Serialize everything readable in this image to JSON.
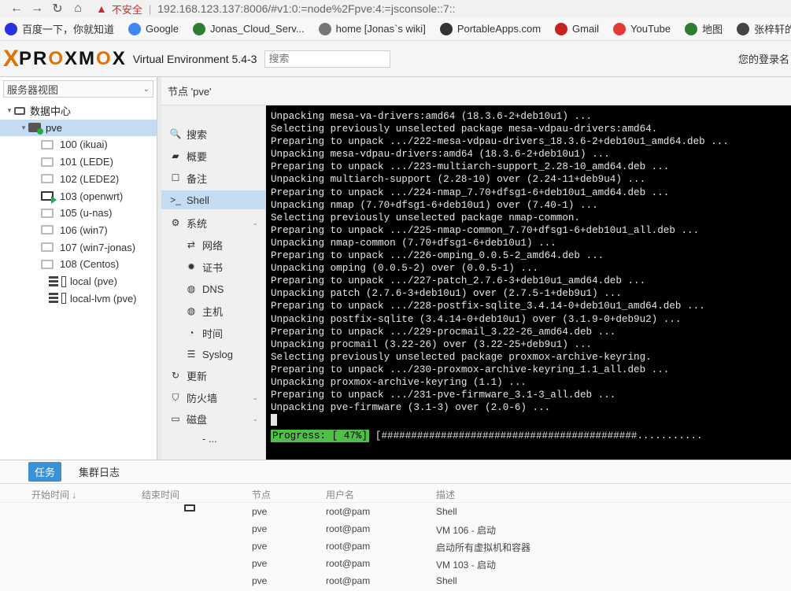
{
  "browser": {
    "security_label": "不安全",
    "url": "192.168.123.137:8006/#v1:0:=node%2Fpve:4:=jsconsole::7::",
    "bookmarks": [
      {
        "label": "百度一下，你就知道",
        "icon": "baidu-icon",
        "color": "#2932e1"
      },
      {
        "label": "Google",
        "icon": "google-icon",
        "color": "#4285f4"
      },
      {
        "label": "Jonas_Cloud_Serv...",
        "icon": "cloud-icon",
        "color": "#2e7d32"
      },
      {
        "label": "home [Jonas`s wiki]",
        "icon": "wiki-icon",
        "color": "#777777"
      },
      {
        "label": "PortableApps.com",
        "icon": "portableapps-icon",
        "color": "#333333"
      },
      {
        "label": "Gmail",
        "icon": "gmail-icon",
        "color": "#c5221f"
      },
      {
        "label": "YouTube",
        "icon": "youtube-icon",
        "color": "#e53935"
      },
      {
        "label": "地图",
        "icon": "maps-icon",
        "color": "#2e7d32"
      },
      {
        "label": "张梓轩的",
        "icon": "globe-icon",
        "color": "#444444"
      }
    ]
  },
  "header": {
    "logo_x": "X",
    "logo_text_1": "PR",
    "logo_text_o1": "O",
    "logo_text_2": "XM",
    "logo_text_o2": "O",
    "logo_text_3": "X",
    "version": "Virtual Environment 5.4-3",
    "search_placeholder": "搜索",
    "login_text": "您的登录名"
  },
  "sidebar": {
    "view_label": "服务器视图",
    "datacenter": "数据中心",
    "node": "pve",
    "vms": [
      {
        "label": "100 (ikuai)",
        "running": false
      },
      {
        "label": "101 (LEDE)",
        "running": false
      },
      {
        "label": "102 (LEDE2)",
        "running": false
      },
      {
        "label": "103 (openwrt)",
        "running": true
      },
      {
        "label": "105 (u-nas)",
        "running": false
      },
      {
        "label": "106 (win7)",
        "running": false
      },
      {
        "label": "107 (win7-jonas)",
        "running": false
      },
      {
        "label": "108 (Centos)",
        "running": false
      }
    ],
    "storage": [
      "local (pve)",
      "local-lvm (pve)"
    ]
  },
  "content": {
    "node_title": "节点 'pve'"
  },
  "nav": {
    "items": [
      {
        "label": "搜索",
        "icon": "search-icon",
        "glyph": "🔍",
        "sub": false,
        "active": false
      },
      {
        "label": "概要",
        "icon": "book-icon",
        "glyph": "▰",
        "sub": false,
        "active": false
      },
      {
        "label": "备注",
        "icon": "note-icon",
        "glyph": "☐",
        "sub": false,
        "active": false
      },
      {
        "label": "Shell",
        "icon": "terminal-icon",
        "glyph": ">_",
        "sub": false,
        "active": true
      },
      {
        "label": "系统",
        "icon": "gears-icon",
        "glyph": "⚙",
        "sub": false,
        "active": false,
        "expandable": true
      },
      {
        "label": "网络",
        "icon": "network-icon",
        "glyph": "⇄",
        "sub": true,
        "active": false
      },
      {
        "label": "证书",
        "icon": "certificate-icon",
        "glyph": "✹",
        "sub": true,
        "active": false
      },
      {
        "label": "DNS",
        "icon": "globe-icon",
        "glyph": "◍",
        "sub": true,
        "active": false
      },
      {
        "label": "主机",
        "icon": "globe-icon",
        "glyph": "◍",
        "sub": true,
        "active": false
      },
      {
        "label": "时间",
        "icon": "clock-icon",
        "glyph": "◔",
        "sub": true,
        "active": false
      },
      {
        "label": "Syslog",
        "icon": "list-icon",
        "glyph": "☰",
        "sub": true,
        "active": false
      },
      {
        "label": "更新",
        "icon": "refresh-icon",
        "glyph": "↻",
        "sub": false,
        "active": false
      },
      {
        "label": "防火墙",
        "icon": "shield-icon",
        "glyph": "⛉",
        "sub": false,
        "active": false,
        "expandable": true
      },
      {
        "label": "磁盘",
        "icon": "disk-icon",
        "glyph": "▭",
        "sub": false,
        "active": false,
        "expandable": true
      },
      {
        "label": "- ...",
        "icon": "more-icon",
        "glyph": "",
        "sub": true,
        "active": false
      }
    ]
  },
  "terminal": {
    "lines": [
      "Unpacking mesa-va-drivers:amd64 (18.3.6-2+deb10u1) ...",
      "Selecting previously unselected package mesa-vdpau-drivers:amd64.",
      "Preparing to unpack .../222-mesa-vdpau-drivers_18.3.6-2+deb10u1_amd64.deb ...",
      "Unpacking mesa-vdpau-drivers:amd64 (18.3.6-2+deb10u1) ...",
      "Preparing to unpack .../223-multiarch-support_2.28-10_amd64.deb ...",
      "Unpacking multiarch-support (2.28-10) over (2.24-11+deb9u4) ...",
      "Preparing to unpack .../224-nmap_7.70+dfsg1-6+deb10u1_amd64.deb ...",
      "Unpacking nmap (7.70+dfsg1-6+deb10u1) over (7.40-1) ...",
      "Selecting previously unselected package nmap-common.",
      "Preparing to unpack .../225-nmap-common_7.70+dfsg1-6+deb10u1_all.deb ...",
      "Unpacking nmap-common (7.70+dfsg1-6+deb10u1) ...",
      "Preparing to unpack .../226-omping_0.0.5-2_amd64.deb ...",
      "Unpacking omping (0.0.5-2) over (0.0.5-1) ...",
      "Preparing to unpack .../227-patch_2.7.6-3+deb10u1_amd64.deb ...",
      "Unpacking patch (2.7.6-3+deb10u1) over (2.7.5-1+deb9u1) ...",
      "Preparing to unpack .../228-postfix-sqlite_3.4.14-0+deb10u1_amd64.deb ...",
      "Unpacking postfix-sqlite (3.4.14-0+deb10u1) over (3.1.9-0+deb9u2) ...",
      "Preparing to unpack .../229-procmail_3.22-26_amd64.deb ...",
      "Unpacking procmail (3.22-26) over (3.22-25+deb9u1) ...",
      "Selecting previously unselected package proxmox-archive-keyring.",
      "Preparing to unpack .../230-proxmox-archive-keyring_1.1_all.deb ...",
      "Unpacking proxmox-archive-keyring (1.1) ...",
      "Preparing to unpack .../231-pve-firmware_3.1-3_all.deb ...",
      "Unpacking pve-firmware (3.1-3) over (2.0-6) ..."
    ],
    "progress_label": "Progress: [ 47%]",
    "progress_bar": "[###########################################..........."
  },
  "tasks": {
    "tabs": [
      {
        "label": "任务",
        "active": true
      },
      {
        "label": "集群日志",
        "active": false
      }
    ],
    "columns": [
      "开始时间 ↓",
      "结束时间",
      "节点",
      "用户名",
      "描述"
    ],
    "rows": [
      {
        "node": "pve",
        "user": "root@pam",
        "desc": "Shell",
        "has_icon": true
      },
      {
        "node": "pve",
        "user": "root@pam",
        "desc": "VM 106 - 启动",
        "has_icon": false
      },
      {
        "node": "pve",
        "user": "root@pam",
        "desc": "启动所有虚拟机和容器",
        "has_icon": false
      },
      {
        "node": "pve",
        "user": "root@pam",
        "desc": "VM 103 - 启动",
        "has_icon": false
      },
      {
        "node": "pve",
        "user": "root@pam",
        "desc": "Shell",
        "has_icon": false
      }
    ]
  },
  "colors": {
    "accent": "#e57000",
    "selection": "#c4dcf2",
    "tab_active": "#3892d4",
    "progress_green": "#4ec045"
  }
}
